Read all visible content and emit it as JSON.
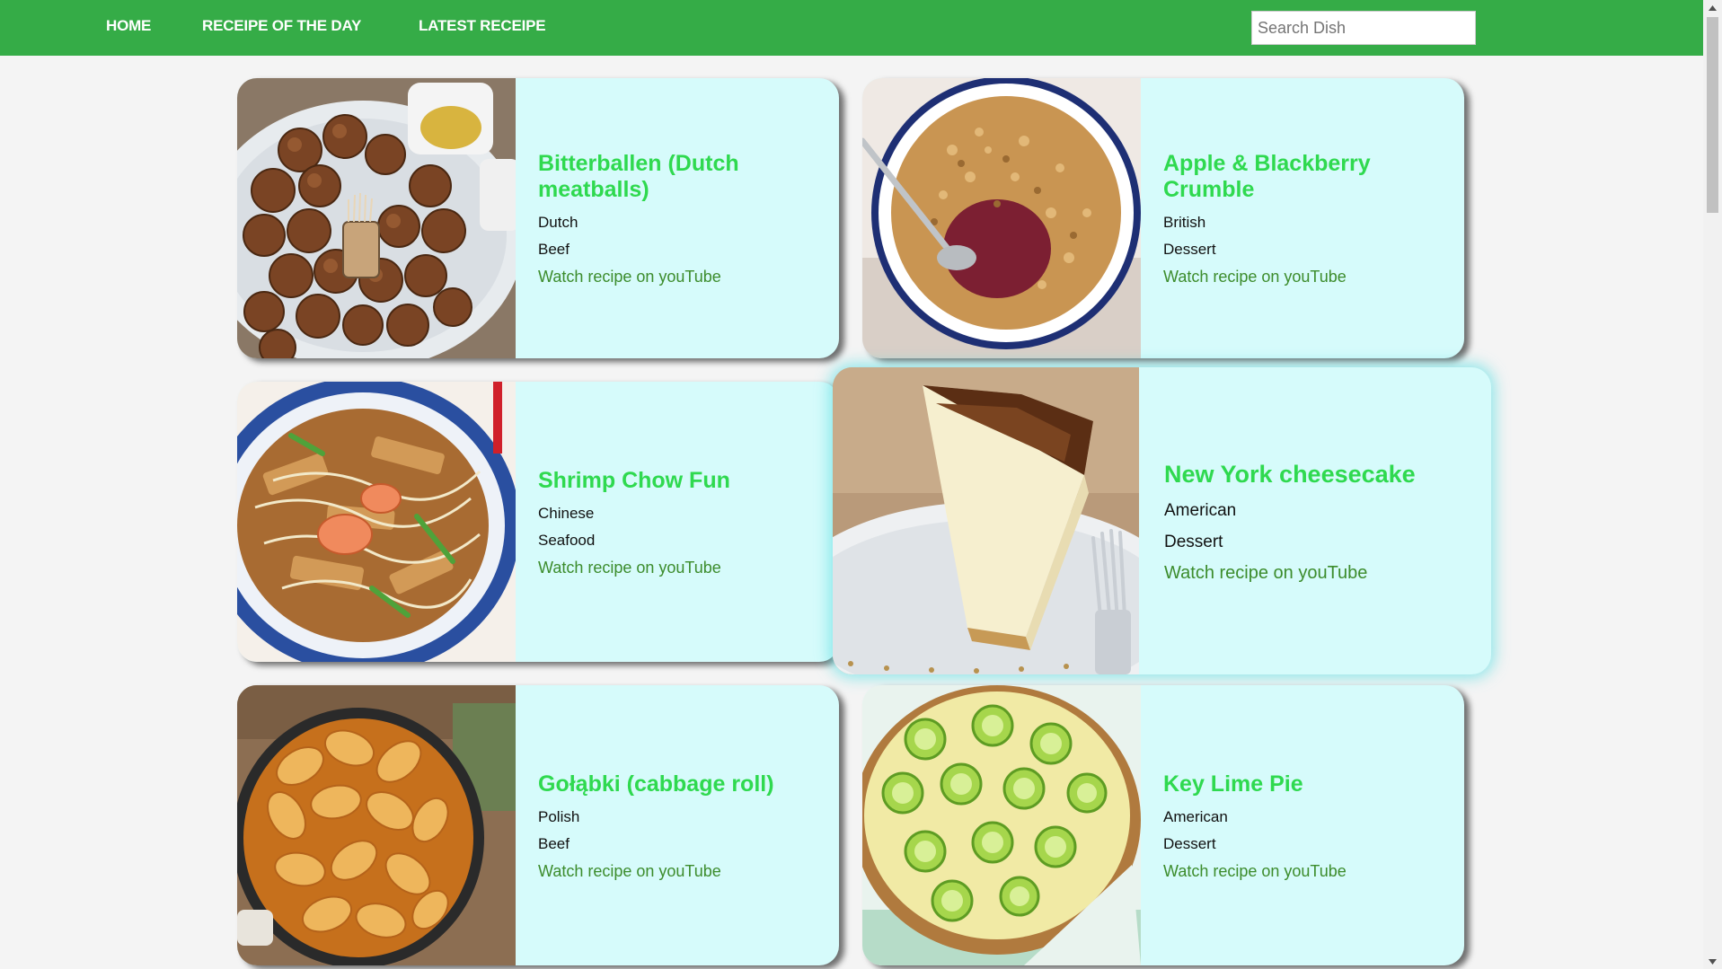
{
  "nav": {
    "links": [
      "HOME",
      "RECEIPE OF THE DAY",
      "LATEST RECEIPE"
    ],
    "search_placeholder": "Search Dish"
  },
  "meals": [
    {
      "name": "Bitterballen (Dutch meatballs)",
      "area": "Dutch",
      "category": "Beef",
      "link_text": "Watch recipe on youTube",
      "image": "bitterballen-photo"
    },
    {
      "name": "Apple & Blackberry Crumble",
      "area": "British",
      "category": "Dessert",
      "link_text": "Watch recipe on youTube",
      "image": "crumble-photo"
    },
    {
      "name": "Shrimp Chow Fun",
      "area": "Chinese",
      "category": "Seafood",
      "link_text": "Watch recipe on youTube",
      "image": "chow-fun-photo"
    },
    {
      "name": "New York cheesecake",
      "area": "American",
      "category": "Dessert",
      "link_text": "Watch recipe on youTube",
      "image": "cheesecake-photo",
      "featured": true
    },
    {
      "name": "Gołąbki (cabbage roll)",
      "area": "Polish",
      "category": "Beef",
      "link_text": "Watch recipe on youTube",
      "image": "golabki-photo"
    },
    {
      "name": "Key Lime Pie",
      "area": "American",
      "category": "Dessert",
      "link_text": "Watch recipe on youTube",
      "image": "key-lime-pie-photo"
    }
  ],
  "colors": {
    "navbar": "#35ac47",
    "card_background": "#d6fbfb",
    "title": "#2fd94f",
    "link": "#3c8c2c"
  }
}
